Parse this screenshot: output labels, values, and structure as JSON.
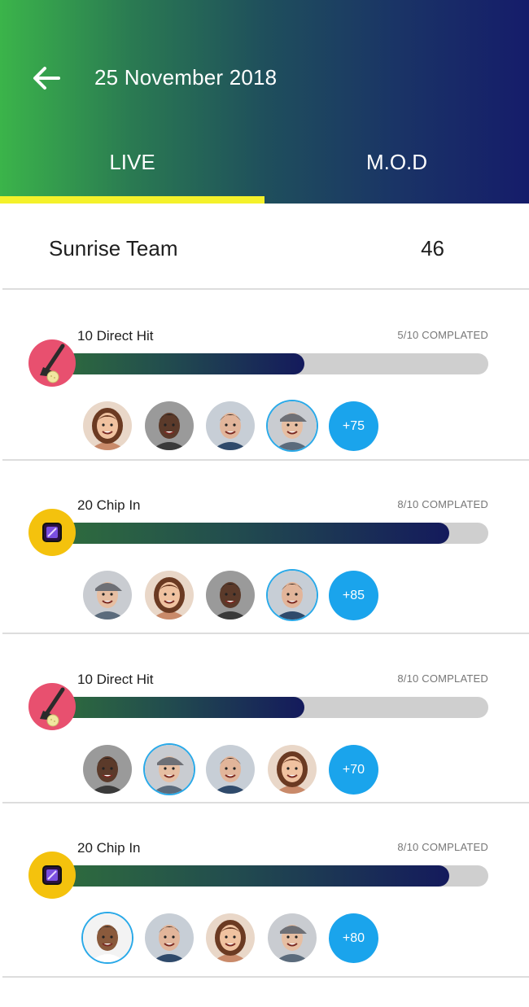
{
  "header": {
    "title": "25 November 2018",
    "back_icon": "arrow-left-icon",
    "tabs": [
      {
        "label": "LIVE",
        "active": true
      },
      {
        "label": "M.O.D",
        "active": false
      }
    ],
    "active_tab_indicator_color": "#f4f12a"
  },
  "team": {
    "name": "Sunrise Team",
    "score": "46"
  },
  "challenges": [
    {
      "title": "10 Direct Hit",
      "status": "5/10 COMPLATED",
      "progress": 0.58,
      "icon": "golf-club-icon",
      "badge_color": "#e8506f",
      "avatars": [
        "woman-brown-hair",
        "man-dark-skin",
        "young-man",
        "man-gray-cap"
      ],
      "more": "+75"
    },
    {
      "title": "20 Chip In",
      "status": "8/10 COMPLATED",
      "progress": 0.91,
      "icon": "purple-target-icon",
      "badge_color": "#f4c20d",
      "avatars": [
        "man-gray-cap",
        "woman-brown-hair",
        "man-dark-skin",
        "young-man"
      ],
      "more": "+85"
    },
    {
      "title": "10 Direct Hit",
      "status": "8/10 COMPLATED",
      "progress": 0.58,
      "icon": "golf-club-icon",
      "badge_color": "#e8506f",
      "avatars": [
        "man-dark-skin",
        "man-gray-cap",
        "young-man",
        "woman-brown-hair"
      ],
      "more": "+70"
    },
    {
      "title": "20 Chip In",
      "status": "8/10 COMPLATED",
      "progress": 0.91,
      "icon": "purple-target-icon",
      "badge_color": "#f4c20d",
      "avatars": [
        "man-smiling-white-shirt",
        "young-man",
        "woman-brown-hair",
        "man-gray-cap"
      ],
      "more": "+80"
    }
  ]
}
